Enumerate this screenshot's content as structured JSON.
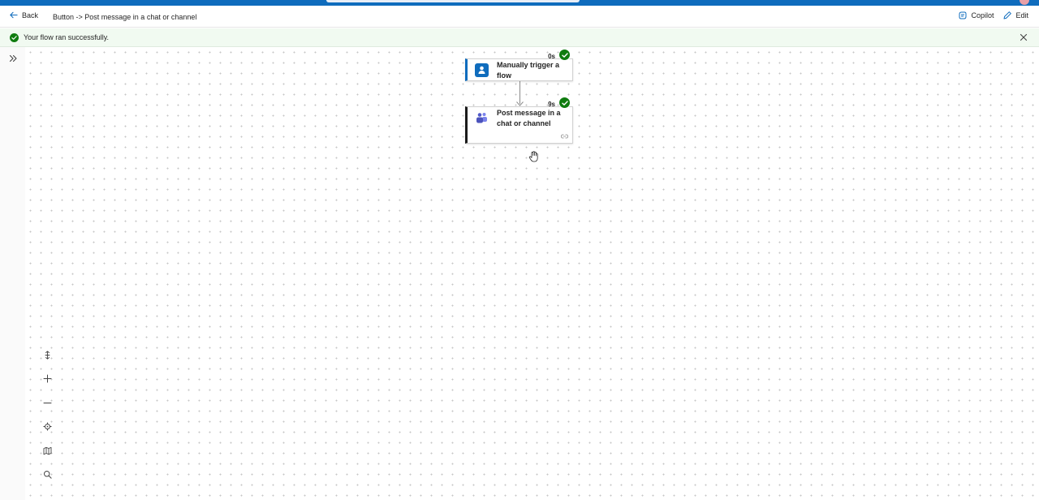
{
  "header": {
    "back_label": "Back",
    "breadcrumb": "Button -> Post message in a chat or channel",
    "copilot_label": "Copilot",
    "edit_label": "Edit"
  },
  "banner": {
    "message": "Your flow ran successfully."
  },
  "flow": {
    "trigger": {
      "title": "Manually trigger a flow",
      "duration": "0s",
      "status": "succeeded"
    },
    "action": {
      "title": "Post message in a chat or channel",
      "duration": "9s",
      "status": "succeeded"
    }
  },
  "colors": {
    "accent": "#0f6cbd",
    "success": "#107c10"
  },
  "icons": {
    "trigger": "manual-trigger-icon",
    "action": "teams-icon",
    "controls": [
      "fit-vertical-icon",
      "zoom-in-icon",
      "zoom-out-icon",
      "center-icon",
      "minimap-icon",
      "search-icon"
    ]
  }
}
